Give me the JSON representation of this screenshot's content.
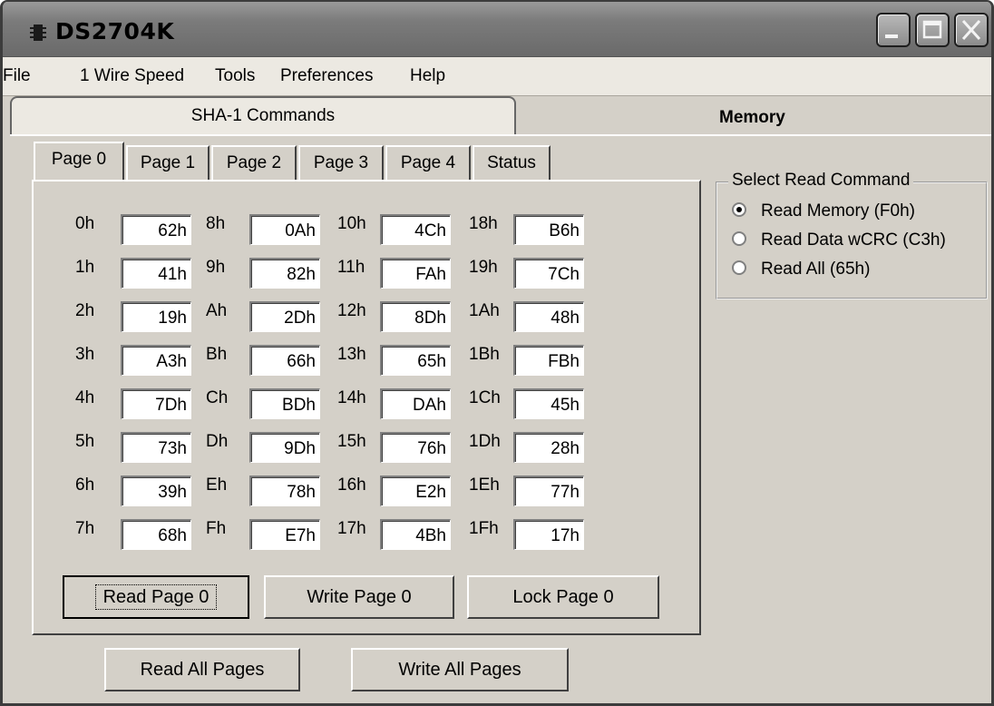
{
  "window": {
    "title": "DS2704K"
  },
  "menu": [
    "File",
    "1 Wire Speed",
    "Tools",
    "Preferences",
    "Help"
  ],
  "top_tabs": {
    "sha": "SHA-1 Commands",
    "memory": "Memory"
  },
  "page_tabs": [
    "Page 0",
    "Page 1",
    "Page 2",
    "Page 3",
    "Page 4",
    "Status"
  ],
  "memory": {
    "col0": [
      {
        "addr": "0h",
        "val": "62h"
      },
      {
        "addr": "1h",
        "val": "41h"
      },
      {
        "addr": "2h",
        "val": "19h"
      },
      {
        "addr": "3h",
        "val": "A3h"
      },
      {
        "addr": "4h",
        "val": "7Dh"
      },
      {
        "addr": "5h",
        "val": "73h"
      },
      {
        "addr": "6h",
        "val": "39h"
      },
      {
        "addr": "7h",
        "val": "68h"
      }
    ],
    "col1": [
      {
        "addr": "8h",
        "val": "0Ah"
      },
      {
        "addr": "9h",
        "val": "82h"
      },
      {
        "addr": "Ah",
        "val": "2Dh"
      },
      {
        "addr": "Bh",
        "val": "66h"
      },
      {
        "addr": "Ch",
        "val": "BDh"
      },
      {
        "addr": "Dh",
        "val": "9Dh"
      },
      {
        "addr": "Eh",
        "val": "78h"
      },
      {
        "addr": "Fh",
        "val": "E7h"
      }
    ],
    "col2": [
      {
        "addr": "10h",
        "val": "4Ch"
      },
      {
        "addr": "11h",
        "val": "FAh"
      },
      {
        "addr": "12h",
        "val": "8Dh"
      },
      {
        "addr": "13h",
        "val": "65h"
      },
      {
        "addr": "14h",
        "val": "DAh"
      },
      {
        "addr": "15h",
        "val": "76h"
      },
      {
        "addr": "16h",
        "val": "E2h"
      },
      {
        "addr": "17h",
        "val": "4Bh"
      }
    ],
    "col3": [
      {
        "addr": "18h",
        "val": "B6h"
      },
      {
        "addr": "19h",
        "val": "7Ch"
      },
      {
        "addr": "1Ah",
        "val": "48h"
      },
      {
        "addr": "1Bh",
        "val": "FBh"
      },
      {
        "addr": "1Ch",
        "val": "45h"
      },
      {
        "addr": "1Dh",
        "val": "28h"
      },
      {
        "addr": "1Eh",
        "val": "77h"
      },
      {
        "addr": "1Fh",
        "val": "17h"
      }
    ]
  },
  "buttons": {
    "read_page": "Read Page 0",
    "write_page": "Write Page 0",
    "lock_page": "Lock Page 0",
    "read_all": "Read All Pages",
    "write_all": "Write All Pages"
  },
  "read_command": {
    "legend": "Select Read Command",
    "options": [
      "Read Memory (F0h)",
      "Read Data wCRC (C3h)",
      "Read All (65h)"
    ],
    "selected_index": 0
  },
  "icons": {
    "app": "chip-icon",
    "minimize": "minimize-icon",
    "maximize": "maximize-icon",
    "close": "close-icon"
  }
}
